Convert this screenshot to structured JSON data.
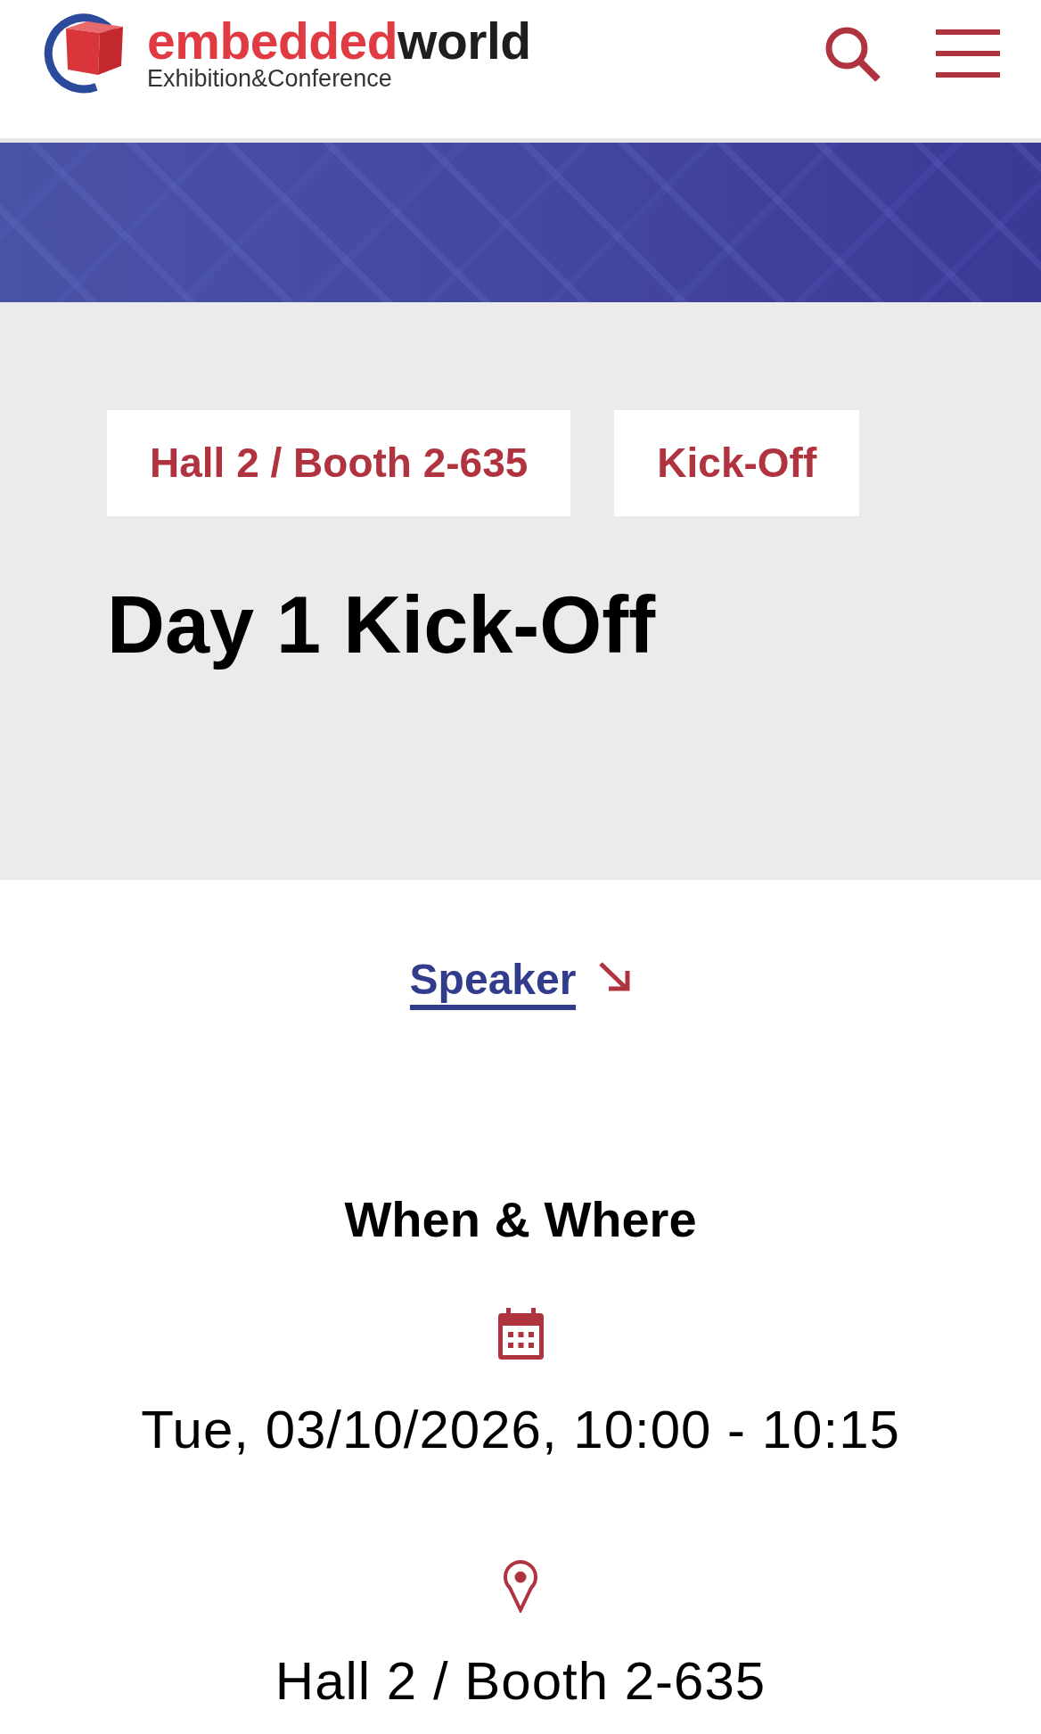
{
  "header": {
    "logo": {
      "wordmark_first": "embedded",
      "wordmark_second": "world",
      "tagline": "Exhibition&Conference"
    }
  },
  "session": {
    "tags": [
      "Hall 2 / Booth 2-635",
      "Kick-Off"
    ],
    "title": "Day 1 Kick-Off"
  },
  "speaker_link": "Speaker",
  "when_where": {
    "heading": "When & Where",
    "items": [
      {
        "kind": "date",
        "text": "Tue, 03/10/2026, 10:00 - 10:15"
      },
      {
        "kind": "location",
        "text": "Hall 2 / Booth 2-635"
      }
    ]
  }
}
